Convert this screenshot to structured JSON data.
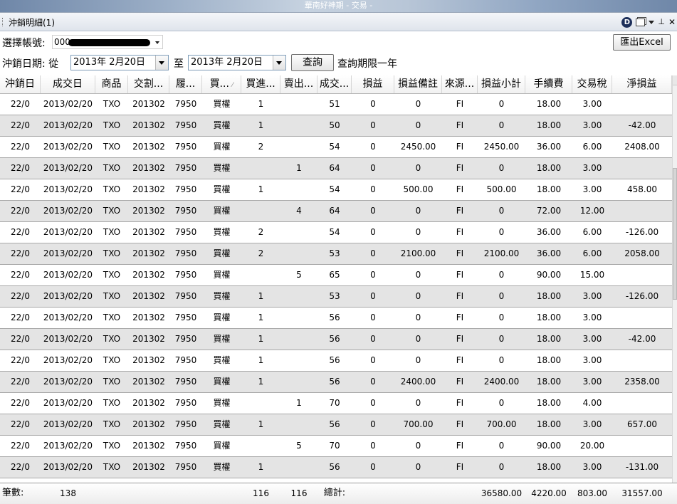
{
  "window": {
    "title": "華南好神期 - 交易 -"
  },
  "panel": {
    "title": "沖銷明細(1)",
    "icon_label": "D"
  },
  "form": {
    "account_label": "選擇帳號:",
    "account_value": "000",
    "date_label": "沖銷日期: 從",
    "date_from": "2013年  2月20日",
    "to_label": "至",
    "date_to": "2013年  2月20日",
    "query_button": "查詢",
    "query_note": "查詢期限一年",
    "export_button": "匯出Excel"
  },
  "table": {
    "columns": [
      "沖銷日",
      "成交日",
      "商品",
      "交割...",
      "履...",
      "買...",
      "買進...",
      "賣出...",
      "成交...",
      "損益",
      "損益備註",
      "來源...",
      "損益小計",
      "手續費",
      "交易稅",
      "淨損益"
    ],
    "rows": [
      [
        "22/0",
        "2013/02/20",
        "TXO",
        "201302",
        "7950",
        "買權",
        "1",
        "",
        "51",
        "0",
        "0",
        "FI",
        "0",
        "18.00",
        "3.00",
        ""
      ],
      [
        "22/0",
        "2013/02/20",
        "TXO",
        "201302",
        "7950",
        "買權",
        "1",
        "",
        "50",
        "0",
        "0",
        "FI",
        "0",
        "18.00",
        "3.00",
        "-42.00"
      ],
      [
        "22/0",
        "2013/02/20",
        "TXO",
        "201302",
        "7950",
        "買權",
        "2",
        "",
        "54",
        "0",
        "2450.00",
        "FI",
        "2450.00",
        "36.00",
        "6.00",
        "2408.00"
      ],
      [
        "22/0",
        "2013/02/20",
        "TXO",
        "201302",
        "7950",
        "買權",
        "",
        "1",
        "64",
        "0",
        "0",
        "FI",
        "0",
        "18.00",
        "3.00",
        ""
      ],
      [
        "22/0",
        "2013/02/20",
        "TXO",
        "201302",
        "7950",
        "買權",
        "1",
        "",
        "54",
        "0",
        "500.00",
        "FI",
        "500.00",
        "18.00",
        "3.00",
        "458.00"
      ],
      [
        "22/0",
        "2013/02/20",
        "TXO",
        "201302",
        "7950",
        "買權",
        "",
        "4",
        "64",
        "0",
        "0",
        "FI",
        "0",
        "72.00",
        "12.00",
        ""
      ],
      [
        "22/0",
        "2013/02/20",
        "TXO",
        "201302",
        "7950",
        "買權",
        "2",
        "",
        "54",
        "0",
        "0",
        "FI",
        "0",
        "36.00",
        "6.00",
        "-126.00"
      ],
      [
        "22/0",
        "2013/02/20",
        "TXO",
        "201302",
        "7950",
        "買權",
        "2",
        "",
        "53",
        "0",
        "2100.00",
        "FI",
        "2100.00",
        "36.00",
        "6.00",
        "2058.00"
      ],
      [
        "22/0",
        "2013/02/20",
        "TXO",
        "201302",
        "7950",
        "買權",
        "",
        "5",
        "65",
        "0",
        "0",
        "FI",
        "0",
        "90.00",
        "15.00",
        ""
      ],
      [
        "22/0",
        "2013/02/20",
        "TXO",
        "201302",
        "7950",
        "買權",
        "1",
        "",
        "53",
        "0",
        "0",
        "FI",
        "0",
        "18.00",
        "3.00",
        "-126.00"
      ],
      [
        "22/0",
        "2013/02/20",
        "TXO",
        "201302",
        "7950",
        "買權",
        "1",
        "",
        "56",
        "0",
        "0",
        "FI",
        "0",
        "18.00",
        "3.00",
        ""
      ],
      [
        "22/0",
        "2013/02/20",
        "TXO",
        "201302",
        "7950",
        "買權",
        "1",
        "",
        "56",
        "0",
        "0",
        "FI",
        "0",
        "18.00",
        "3.00",
        "-42.00"
      ],
      [
        "22/0",
        "2013/02/20",
        "TXO",
        "201302",
        "7950",
        "買權",
        "1",
        "",
        "56",
        "0",
        "0",
        "FI",
        "0",
        "18.00",
        "3.00",
        ""
      ],
      [
        "22/0",
        "2013/02/20",
        "TXO",
        "201302",
        "7950",
        "買權",
        "1",
        "",
        "56",
        "0",
        "2400.00",
        "FI",
        "2400.00",
        "18.00",
        "3.00",
        "2358.00"
      ],
      [
        "22/0",
        "2013/02/20",
        "TXO",
        "201302",
        "7950",
        "買權",
        "",
        "1",
        "70",
        "0",
        "0",
        "FI",
        "0",
        "18.00",
        "4.00",
        ""
      ],
      [
        "22/0",
        "2013/02/20",
        "TXO",
        "201302",
        "7950",
        "買權",
        "1",
        "",
        "56",
        "0",
        "700.00",
        "FI",
        "700.00",
        "18.00",
        "3.00",
        "657.00"
      ],
      [
        "22/0",
        "2013/02/20",
        "TXO",
        "201302",
        "7950",
        "買權",
        "",
        "5",
        "70",
        "0",
        "0",
        "FI",
        "0",
        "90.00",
        "20.00",
        ""
      ],
      [
        "22/0",
        "2013/02/20",
        "TXO",
        "201302",
        "7950",
        "買權",
        "1",
        "",
        "56",
        "0",
        "0",
        "FI",
        "0",
        "18.00",
        "3.00",
        "-131.00"
      ]
    ]
  },
  "summary": {
    "count_label": "筆數:",
    "count": "138",
    "buy_total": "116",
    "sell_total": "116",
    "total_label": "總計:",
    "pl_subtotal": "36580.00",
    "fee": "4220.00",
    "tax": "803.00",
    "net": "31557.00"
  }
}
